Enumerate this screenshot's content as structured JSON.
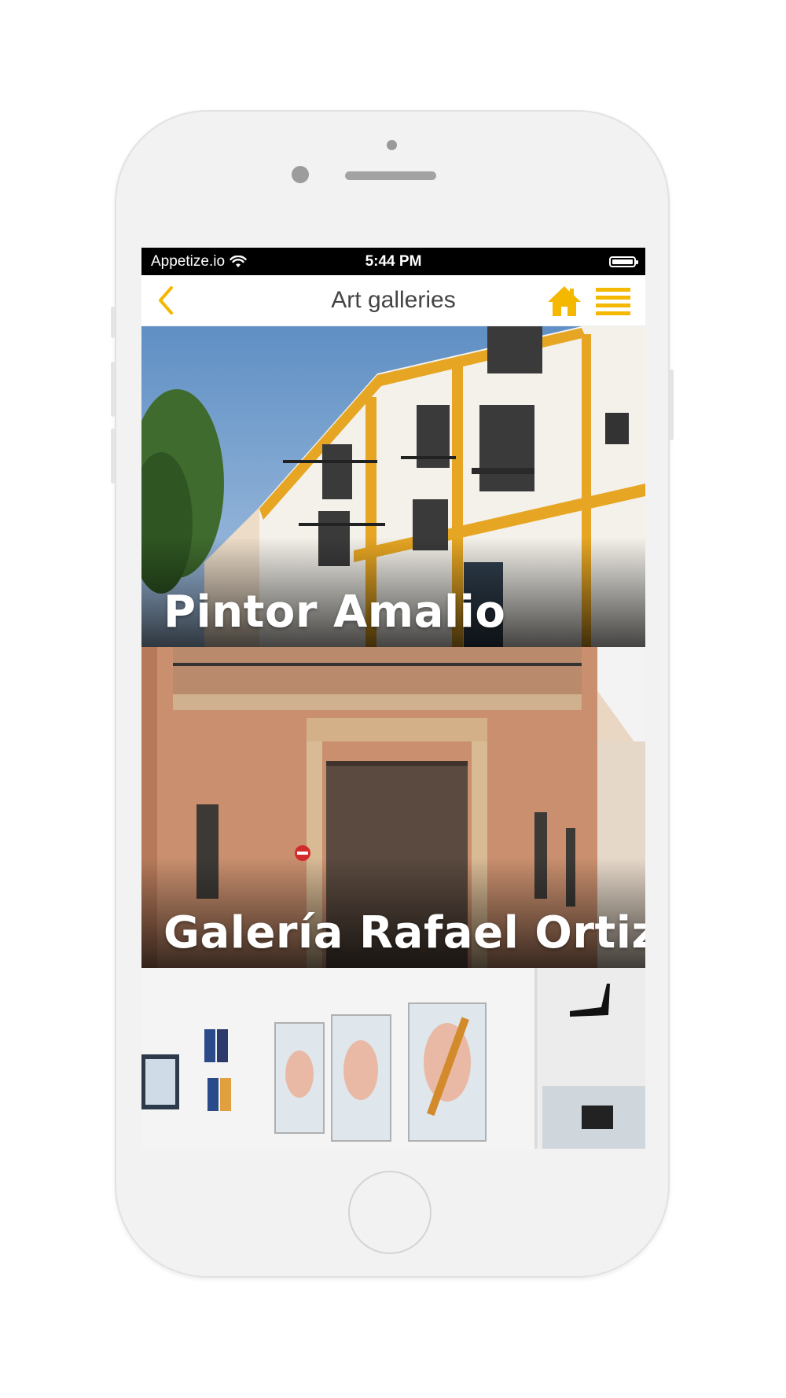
{
  "status_bar": {
    "carrier": "Appetize.io",
    "time": "5:44 PM"
  },
  "nav": {
    "title": "Art galleries",
    "icons": [
      "chevron-left-icon",
      "home-icon",
      "menu-icon"
    ]
  },
  "colors": {
    "accent": "#f5b800",
    "title_text": "#444444",
    "status_bar_bg": "#000000",
    "phone_body": "#f2f2f2"
  },
  "galleries": [
    {
      "name": "Pintor Amalio"
    },
    {
      "name": "Galería Rafael Ortiz"
    },
    {
      "name": ""
    }
  ]
}
